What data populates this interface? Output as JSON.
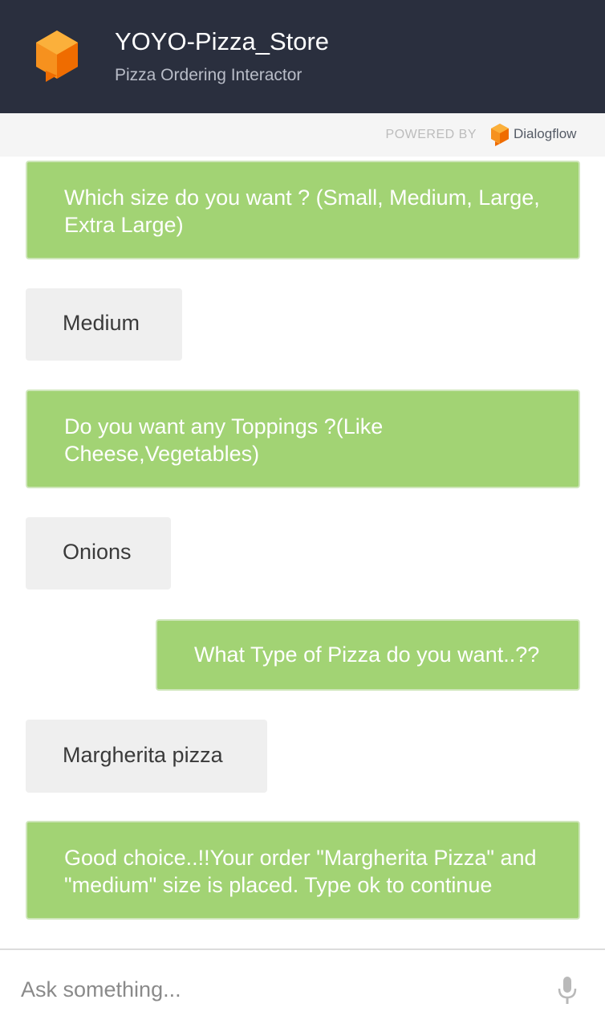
{
  "header": {
    "title": "YOYO-Pizza_Store",
    "subtitle": "Pizza Ordering Interactor",
    "logo_icon": "orange-cube-chat-icon"
  },
  "powered_by": {
    "label": "POWERED BY",
    "brand": "Dialogflow",
    "brand_icon": "dialogflow-logo-icon"
  },
  "messages": [
    {
      "sender": "bot",
      "text": "Which size do you want ? (Small, Medium, Large, Extra Large)"
    },
    {
      "sender": "user",
      "text": "Medium"
    },
    {
      "sender": "bot",
      "text": "Do you want any Toppings ?(Like Cheese,Vegetables)"
    },
    {
      "sender": "user",
      "text": "Onions"
    },
    {
      "sender": "bot",
      "text": "What Type of Pizza do you want..??"
    },
    {
      "sender": "user",
      "text": "Margherita pizza"
    },
    {
      "sender": "bot",
      "text": "Good choice..!!Your order \"Margherita Pizza\" and \"medium\" size is placed. Type ok to continue"
    }
  ],
  "composer": {
    "placeholder": "Ask something...",
    "value": "",
    "mic_icon": "microphone-icon"
  },
  "colors": {
    "header_bg": "#2a2f3e",
    "bot_bubble": "#a2d374",
    "user_bubble": "#efefef",
    "logo_orange": "#f6911e"
  }
}
